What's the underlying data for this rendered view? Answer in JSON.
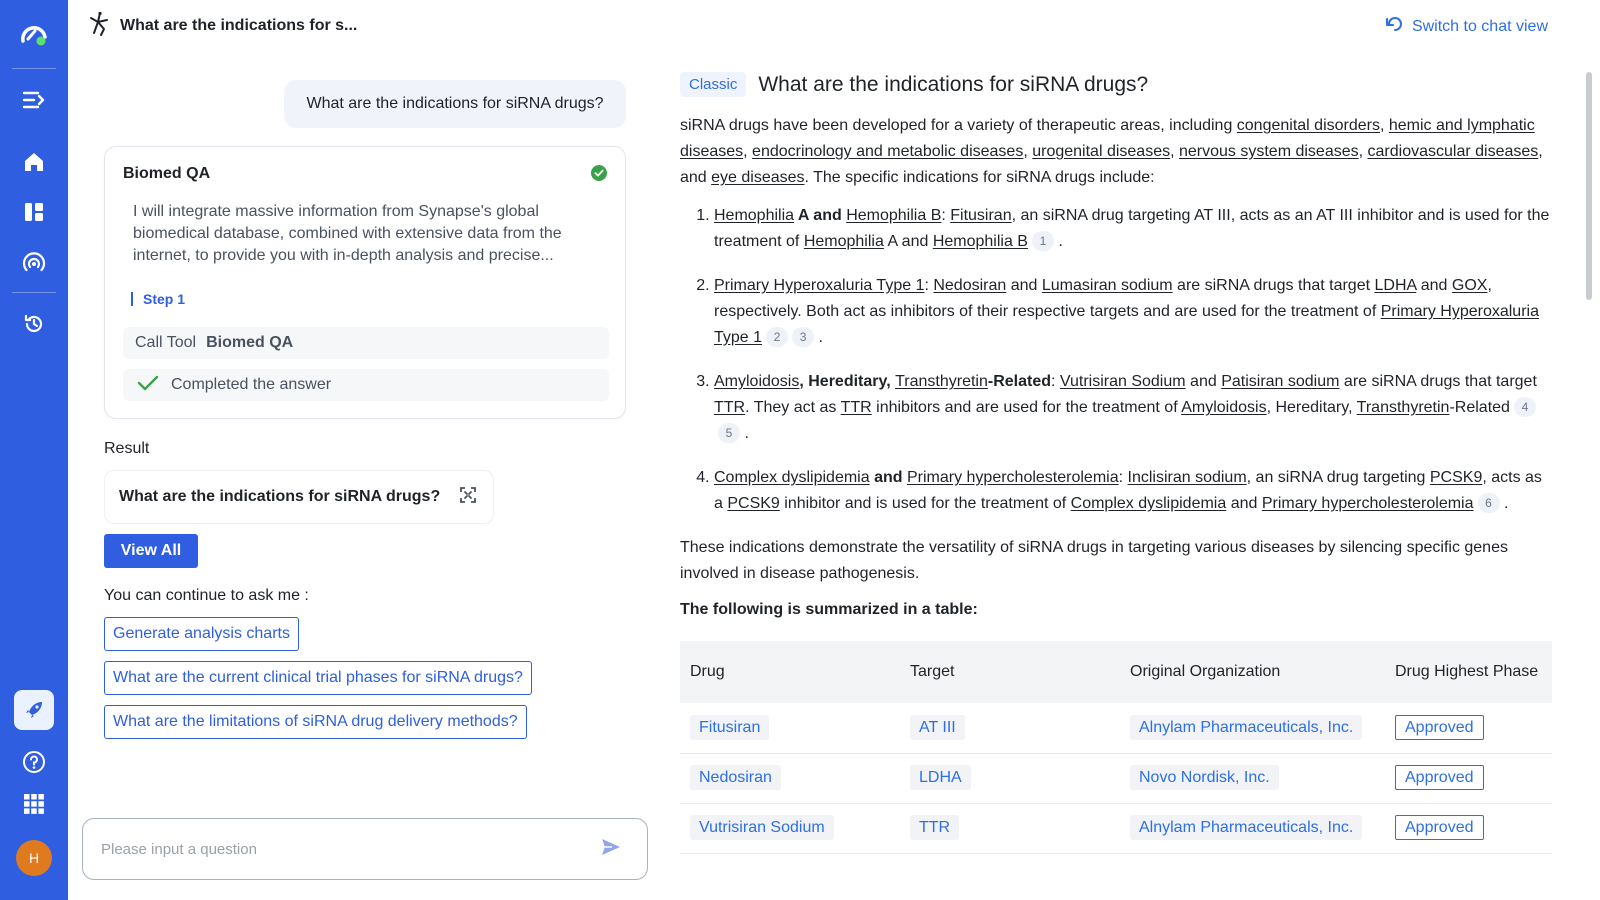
{
  "header": {
    "title": "What are the indications for s...",
    "switch_label": "Switch to chat view"
  },
  "user_question": "What are the indications for siRNA drugs?",
  "agent_card": {
    "title": "Biomed QA",
    "description": "I will integrate massive information from Synapse's global biomedical database, combined with extensive data from the internet, to provide you with in-depth analysis and precise...",
    "step_label": "Step 1",
    "call_tool_label": "Call Tool",
    "tool_name": "Biomed QA",
    "completed_label": "Completed the answer"
  },
  "result": {
    "label": "Result",
    "card_title": "What are the indications for siRNA drugs?",
    "view_all_label": "View All"
  },
  "continue_label": "You can continue to ask me :",
  "suggestions": [
    "Generate analysis charts",
    "What are the current clinical trial phases for siRNA drugs?",
    "What are the limitations of siRNA drug delivery methods?"
  ],
  "input": {
    "placeholder": "Please input a question"
  },
  "user": {
    "avatar_initial": "H"
  },
  "answer": {
    "badge": "Classic",
    "title": "What are the indications for siRNA drugs?",
    "intro": {
      "p1": "siRNA drugs have been developed for a variety of therapeutic areas, including ",
      "a1": "congenital disorders",
      "a2": "hemic and lymphatic diseases",
      "a3": "endocrinology and metabolic diseases",
      "a4": "urogenital diseases",
      "a5": "nervous system diseases",
      "a6": "cardiovascular diseases",
      "and": ", and ",
      "a7": "eye diseases",
      "end": ". The specific indications for siRNA drugs include:"
    },
    "items": [
      {
        "l1": "Hemophilia",
        "b1": " A and ",
        "l2": "Hemophilia B",
        "c1": ": ",
        "l3": "Fitusiran",
        "t1": ", an siRNA drug targeting AT III, acts as an AT III inhibitor and is used for the treatment of ",
        "l4": "Hemophilia",
        "t2": " A and ",
        "l5": "Hemophilia B",
        "cites": [
          "1"
        ]
      },
      {
        "l1": "Primary Hyperoxaluria Type 1",
        "c1": ": ",
        "l2": "Nedosiran",
        "t1": " and ",
        "l3": "Lumasiran sodium",
        "t2": " are siRNA drugs that target ",
        "l4": "LDHA",
        "t3": " and ",
        "l5": "GOX",
        "t4": ", respectively. Both act as inhibitors of their respective targets and are used for the treatment of ",
        "l6": "Primary Hyperoxaluria Type 1",
        "cites": [
          "2",
          "3"
        ]
      },
      {
        "l1": "Amyloidosis",
        "b1": ", Hereditary, ",
        "l2": "Transthyretin",
        "b2": "-Related",
        "c1": ": ",
        "l3": "Vutrisiran Sodium",
        "t1": " and ",
        "l4": "Patisiran sodium",
        "t2": " are siRNA drugs that target ",
        "l5": "TTR",
        "t3": ". They act as ",
        "l6": "TTR",
        "t4": " inhibitors and are used for the treatment of ",
        "l7": "Amyloidosis",
        "t5": ", Hereditary, ",
        "l8": "Transthyretin",
        "t6": "-Related",
        "cites": [
          "4",
          "5"
        ]
      },
      {
        "l1": "Complex dyslipidemia",
        "b1": " and ",
        "l2": "Primary hypercholesterolemia",
        "c1": ": ",
        "l3": "Inclisiran sodium",
        "t1": ", an siRNA drug targeting ",
        "l4": "PCSK9",
        "t2": ", acts as a ",
        "l5": "PCSK9",
        "t3": " inhibitor and is used for the treatment of ",
        "l6": "Complex dyslipidemia",
        "t4": " and ",
        "l7": "Primary hypercholesterolemia",
        "cites": [
          "6"
        ]
      }
    ],
    "conclusion": "These indications demonstrate the versatility of siRNA drugs in targeting various diseases by silencing specific genes involved in disease pathogenesis.",
    "summary_label": "The following is summarized in a table:",
    "table": {
      "headers": [
        "Drug",
        "Target",
        "Original Organization",
        "Drug Highest Phase"
      ],
      "rows": [
        [
          "Fitusiran",
          "AT III",
          "Alnylam Pharmaceuticals, Inc.",
          "Approved"
        ],
        [
          "Nedosiran",
          "LDHA",
          "Novo Nordisk, Inc.",
          "Approved"
        ],
        [
          "Vutrisiran Sodium",
          "TTR",
          "Alnylam Pharmaceuticals, Inc.",
          "Approved"
        ]
      ]
    }
  },
  "icons": [
    "logo-icon",
    "expand-sidebar-icon",
    "home-icon",
    "dashboard-icon",
    "radar-icon",
    "history-icon",
    "rocket-icon",
    "help-icon",
    "apps-grid-icon",
    "undo-arrow-icon",
    "check-circle-icon",
    "checkmark-icon",
    "fullscreen-icon",
    "send-icon",
    "agent-icon"
  ],
  "colors": {
    "sidebar": "#2f5fe0",
    "accent": "#2f6fe4",
    "success": "#3aa34a",
    "avatar": "#e07a1f"
  }
}
